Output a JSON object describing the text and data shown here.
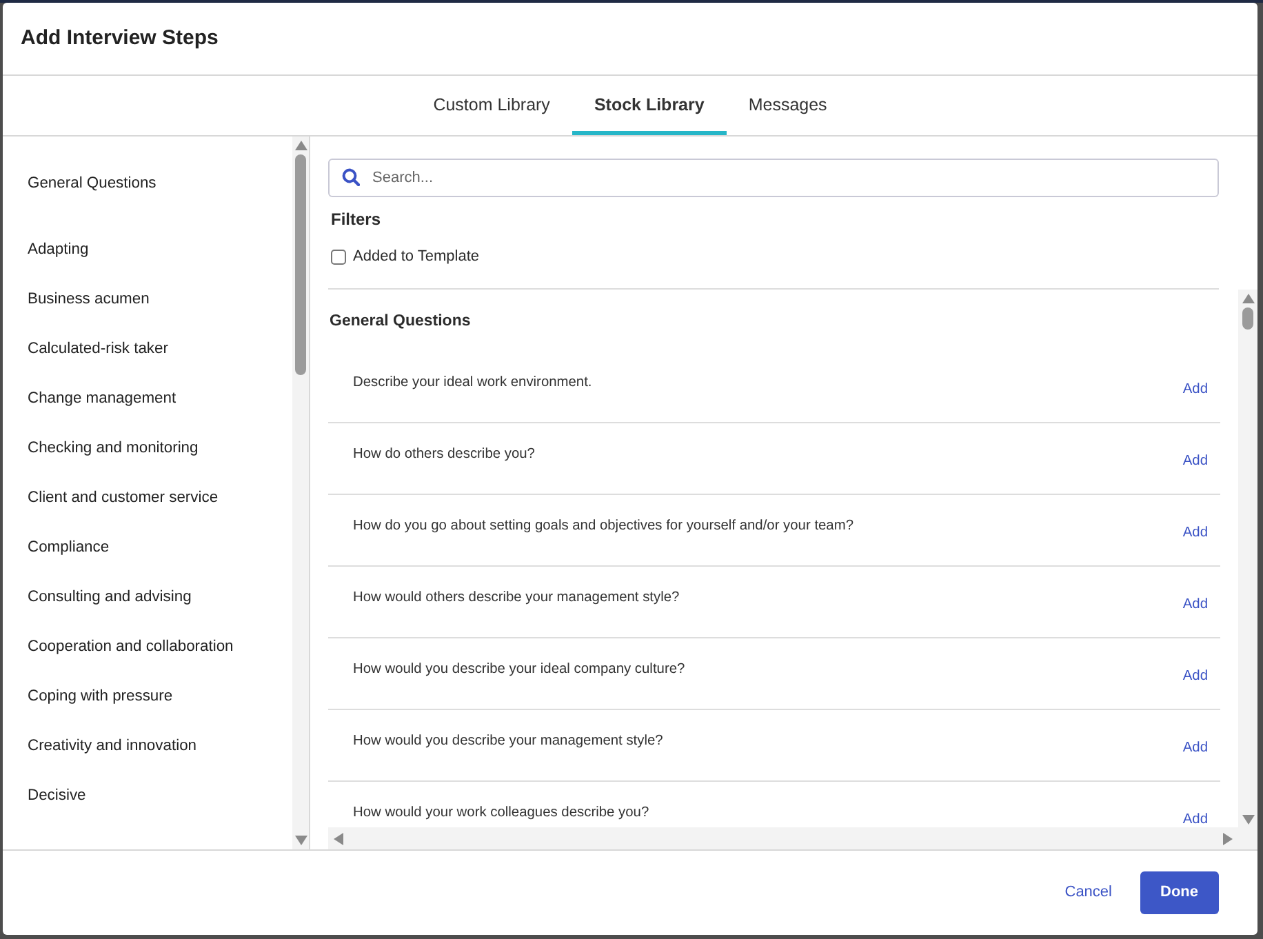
{
  "dialog": {
    "title": "Add Interview Steps"
  },
  "tabs": [
    {
      "label": "Custom Library",
      "selected": false
    },
    {
      "label": "Stock Library",
      "selected": true
    },
    {
      "label": "Messages",
      "selected": false
    }
  ],
  "sidebar": {
    "items": [
      {
        "label": "General Questions",
        "kind": "group"
      },
      {
        "label": "Adapting",
        "kind": "item"
      },
      {
        "label": "Business acumen",
        "kind": "item"
      },
      {
        "label": "Calculated-risk taker",
        "kind": "item"
      },
      {
        "label": "Change management",
        "kind": "item"
      },
      {
        "label": "Checking and monitoring",
        "kind": "item"
      },
      {
        "label": "Client and customer service",
        "kind": "item"
      },
      {
        "label": "Compliance",
        "kind": "item"
      },
      {
        "label": "Consulting and advising",
        "kind": "item"
      },
      {
        "label": "Cooperation and collaboration",
        "kind": "item"
      },
      {
        "label": "Coping with pressure",
        "kind": "item"
      },
      {
        "label": "Creativity and innovation",
        "kind": "item"
      },
      {
        "label": "Decisive",
        "kind": "item"
      }
    ]
  },
  "search": {
    "placeholder": "Search..."
  },
  "filters": {
    "title": "Filters",
    "options": [
      {
        "label": "Added to Template",
        "checked": false
      }
    ]
  },
  "section": {
    "title": "General Questions",
    "questions": [
      {
        "text": "Describe your ideal work environment.",
        "action": "Add"
      },
      {
        "text": "How do others describe you?",
        "action": "Add"
      },
      {
        "text": "How do you go about setting goals and objectives for yourself and/or your team?",
        "action": "Add"
      },
      {
        "text": "How would others describe your management style?",
        "action": "Add"
      },
      {
        "text": "How would you describe your ideal company culture?",
        "action": "Add"
      },
      {
        "text": "How would you describe your management style?",
        "action": "Add"
      },
      {
        "text": "How would your work colleagues describe you?",
        "action": "Add"
      }
    ]
  },
  "footer": {
    "buttons": [
      {
        "label": "Cancel",
        "kind": "link"
      },
      {
        "label": "Done",
        "kind": "primary"
      }
    ]
  }
}
